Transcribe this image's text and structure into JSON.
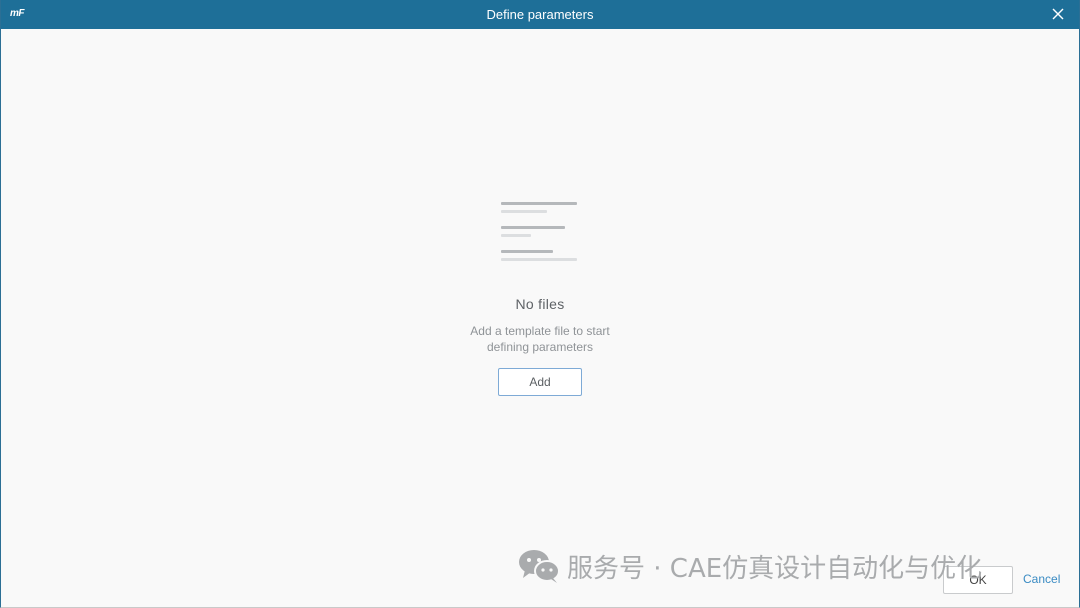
{
  "window": {
    "logo": "mF",
    "title": "Define parameters"
  },
  "empty_state": {
    "icon": "document-lines-icon",
    "title": "No files",
    "description_line1": "Add a template file to start",
    "description_line2": "defining parameters",
    "add_label": "Add"
  },
  "watermark": {
    "text": "服务号 · CAE仿真设计自动化与优化",
    "icon": "wechat-icon"
  },
  "footer": {
    "ok_label": "OK",
    "cancel_label": "Cancel"
  },
  "colors": {
    "titlebar": "#1e6f98",
    "accent": "#3a8bc3",
    "background": "#f9f9f9"
  }
}
